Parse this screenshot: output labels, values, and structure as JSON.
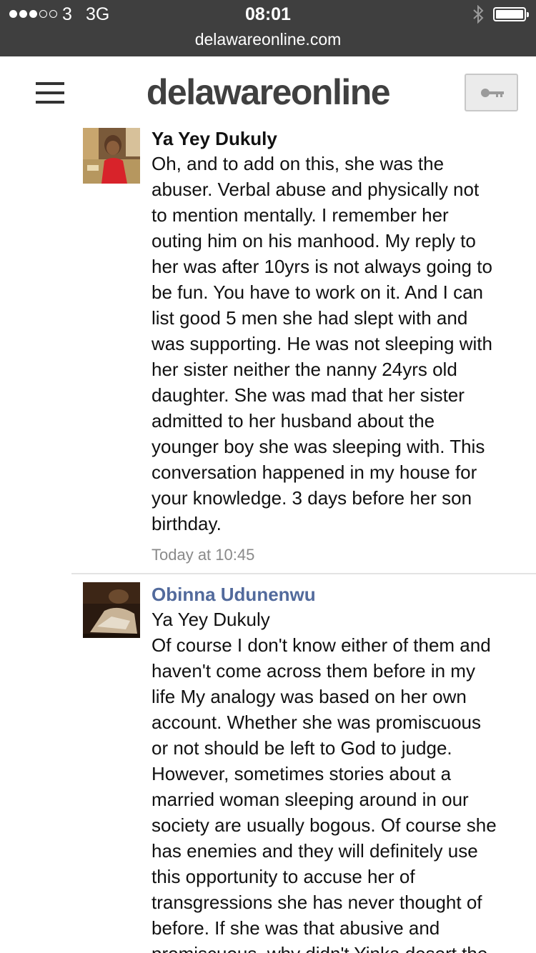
{
  "status_bar": {
    "carrier": "3",
    "network": "3G",
    "time": "08:01"
  },
  "browser": {
    "url": "delawareonline.com"
  },
  "site": {
    "logo": "delawareonline",
    "menu_icon": "hamburger-menu-icon",
    "login_icon": "key-icon"
  },
  "comments": [
    {
      "author": "Ya Yey Dukuly",
      "text_lines": [
        "Oh, and to add on this, she was the",
        "abuser. Verbal abuse and physically not",
        "to mention mentally. I remember her",
        "outing him on his manhood. My reply to",
        "her was after 10yrs is not always going to",
        "be fun. You have to work on it. And I can",
        "list good 5 men she had slept with and",
        "was supporting. He was not sleeping with",
        "her sister neither the nanny 24yrs old",
        "daughter. She was mad that her sister",
        "admitted to her husband about the",
        "younger boy she was sleeping with. This",
        "conversation happened in my house for",
        "your knowledge. 3 days before her son",
        "birthday."
      ],
      "timestamp": "Today at 10:45"
    },
    {
      "author": "Obinna Udunenwu",
      "reply_to": "Ya Yey Dukuly",
      "text_lines": [
        "Of course I don't know either of them and",
        "haven't come across them before in my",
        "life My analogy was based on her own",
        "account. Whether she was promiscuous",
        "or not should be left to God to judge.",
        "However, sometimes stories about a",
        "married woman sleeping around in our",
        "society are usually bogous. Of course she",
        "has enemies and they will definitely use",
        "this opportunity to accuse her of",
        "transgressions she has never thought of",
        "before. If she was that abusive and",
        "promiscuous, why didn't Yinka desert the"
      ]
    }
  ]
}
